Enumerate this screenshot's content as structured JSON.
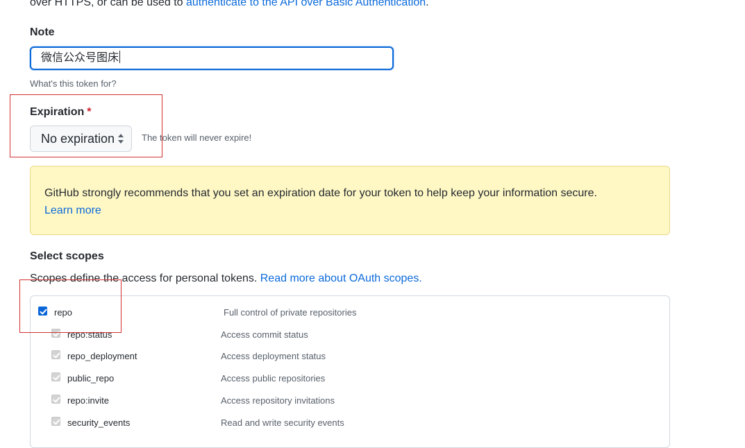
{
  "intro": {
    "text": "over HTTPS, or can be used to ",
    "link": "authenticate to the API over Basic Authentication",
    "suffix": "."
  },
  "note": {
    "label": "Note",
    "value": "微信公众号图床",
    "hint": "What's this token for?"
  },
  "expiration": {
    "label": "Expiration",
    "required_mark": "*",
    "selected": "No expiration",
    "note": "The token will never expire!"
  },
  "flash": {
    "text": "GitHub strongly recommends that you set an expiration date for your token to help keep your information secure.",
    "link": "Learn more"
  },
  "scopes": {
    "label": "Select scopes",
    "description": "Scopes define the access for personal tokens. ",
    "link": "Read more about OAuth scopes.",
    "parent": {
      "name": "repo",
      "description": "Full control of private repositories",
      "checked": true
    },
    "children": [
      {
        "name": "repo:status",
        "description": "Access commit status"
      },
      {
        "name": "repo_deployment",
        "description": "Access deployment status"
      },
      {
        "name": "public_repo",
        "description": "Access public repositories"
      },
      {
        "name": "repo:invite",
        "description": "Access repository invitations"
      },
      {
        "name": "security_events",
        "description": "Read and write security events"
      }
    ]
  },
  "colors": {
    "link": "#0969da",
    "flash_bg": "#fff8c5",
    "checkbox": "#0a66d8",
    "annotation": "#d32f2f"
  }
}
